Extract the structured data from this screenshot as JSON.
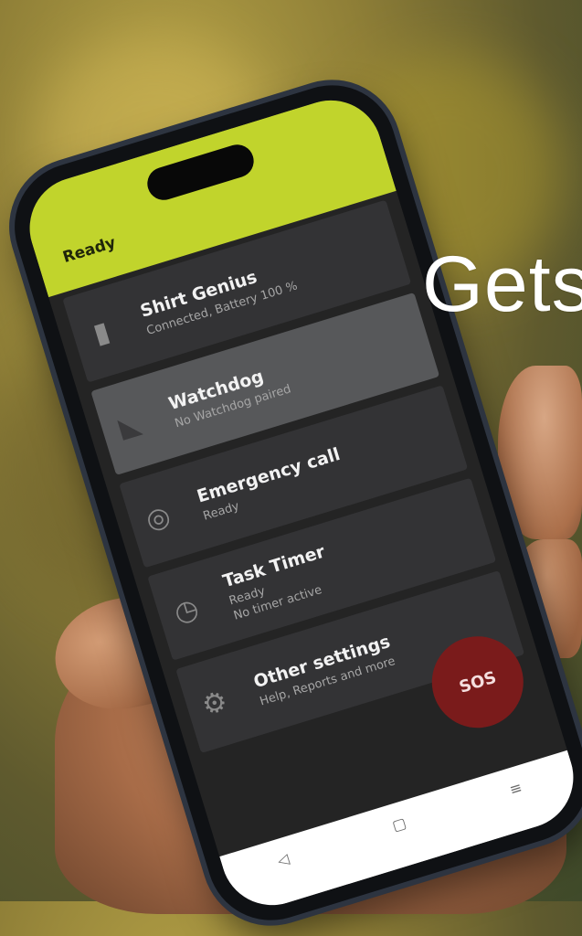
{
  "overlay": {
    "headline": "Gets"
  },
  "app": {
    "status": "Ready",
    "items": [
      {
        "title": "Shirt Genius",
        "subtitle": "Connected, Battery 100 %",
        "icon": "device-icon"
      },
      {
        "title": "Watchdog",
        "subtitle": "No Watchdog paired",
        "icon": "dog-icon"
      },
      {
        "title": "Emergency call",
        "subtitle": "Ready",
        "icon": "headset-icon"
      },
      {
        "title": "Task Timer",
        "subtitle": "Ready",
        "subtitle2": "No timer active",
        "icon": "clock-icon"
      },
      {
        "title": "Other settings",
        "subtitle": "Help, Reports and more",
        "icon": "gear-icon"
      }
    ],
    "sos_label": "SOS",
    "colors": {
      "accent": "#c1d42c",
      "sos": "#7a1b1b",
      "screen": "#242424"
    }
  }
}
